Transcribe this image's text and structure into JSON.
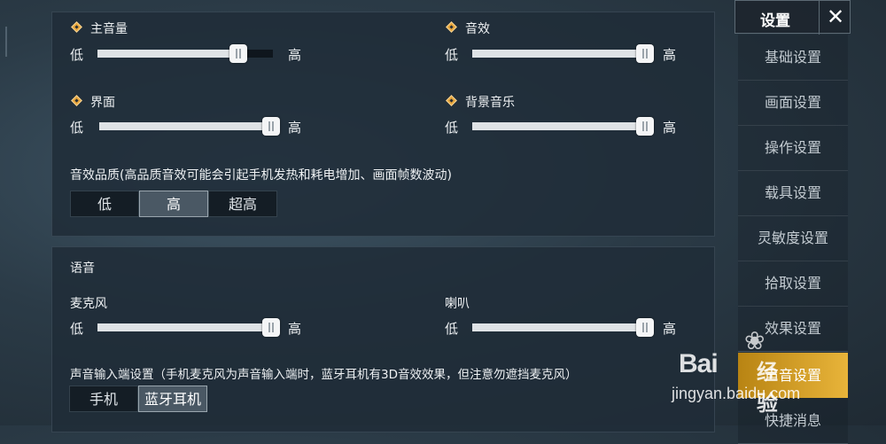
{
  "audio": {
    "master": {
      "label": "主音量",
      "low": "低",
      "high": "高",
      "value": 0.82
    },
    "effects": {
      "label": "音效",
      "low": "低",
      "high": "高",
      "value": 1.0
    },
    "ui": {
      "label": "界面",
      "low": "低",
      "high": "高",
      "value": 1.0
    },
    "music": {
      "label": "背景音乐",
      "low": "低",
      "high": "高",
      "value": 1.0
    },
    "quality": {
      "label": "音效品质(高品质音效可能会引起手机发热和耗电增加、画面帧数波动)",
      "options": [
        "低",
        "高",
        "超高"
      ],
      "selected": "高"
    }
  },
  "voice": {
    "title": "语音",
    "mic": {
      "label": "麦克风",
      "low": "低",
      "high": "高",
      "value": 1.0
    },
    "speaker": {
      "label": "喇叭",
      "low": "低",
      "high": "高",
      "value": 1.0
    },
    "input": {
      "label": "声音输入端设置（手机麦克风为声音输入端时，蓝牙耳机有3D音效效果，但注意勿遮挡麦克风）",
      "options": [
        "手机",
        "蓝牙耳机"
      ],
      "selected": "蓝牙耳机"
    }
  },
  "sidebar": {
    "title": "设置",
    "close": "✕",
    "items": [
      "基础设置",
      "画面设置",
      "操作设置",
      "载具设置",
      "灵敏度设置",
      "拾取设置",
      "效果设置",
      "声音设置",
      "快捷消息"
    ],
    "active": "声音设置"
  },
  "watermark": {
    "brand": "Bai",
    "cn": "经验",
    "url": "jingyan.baidu.com"
  }
}
